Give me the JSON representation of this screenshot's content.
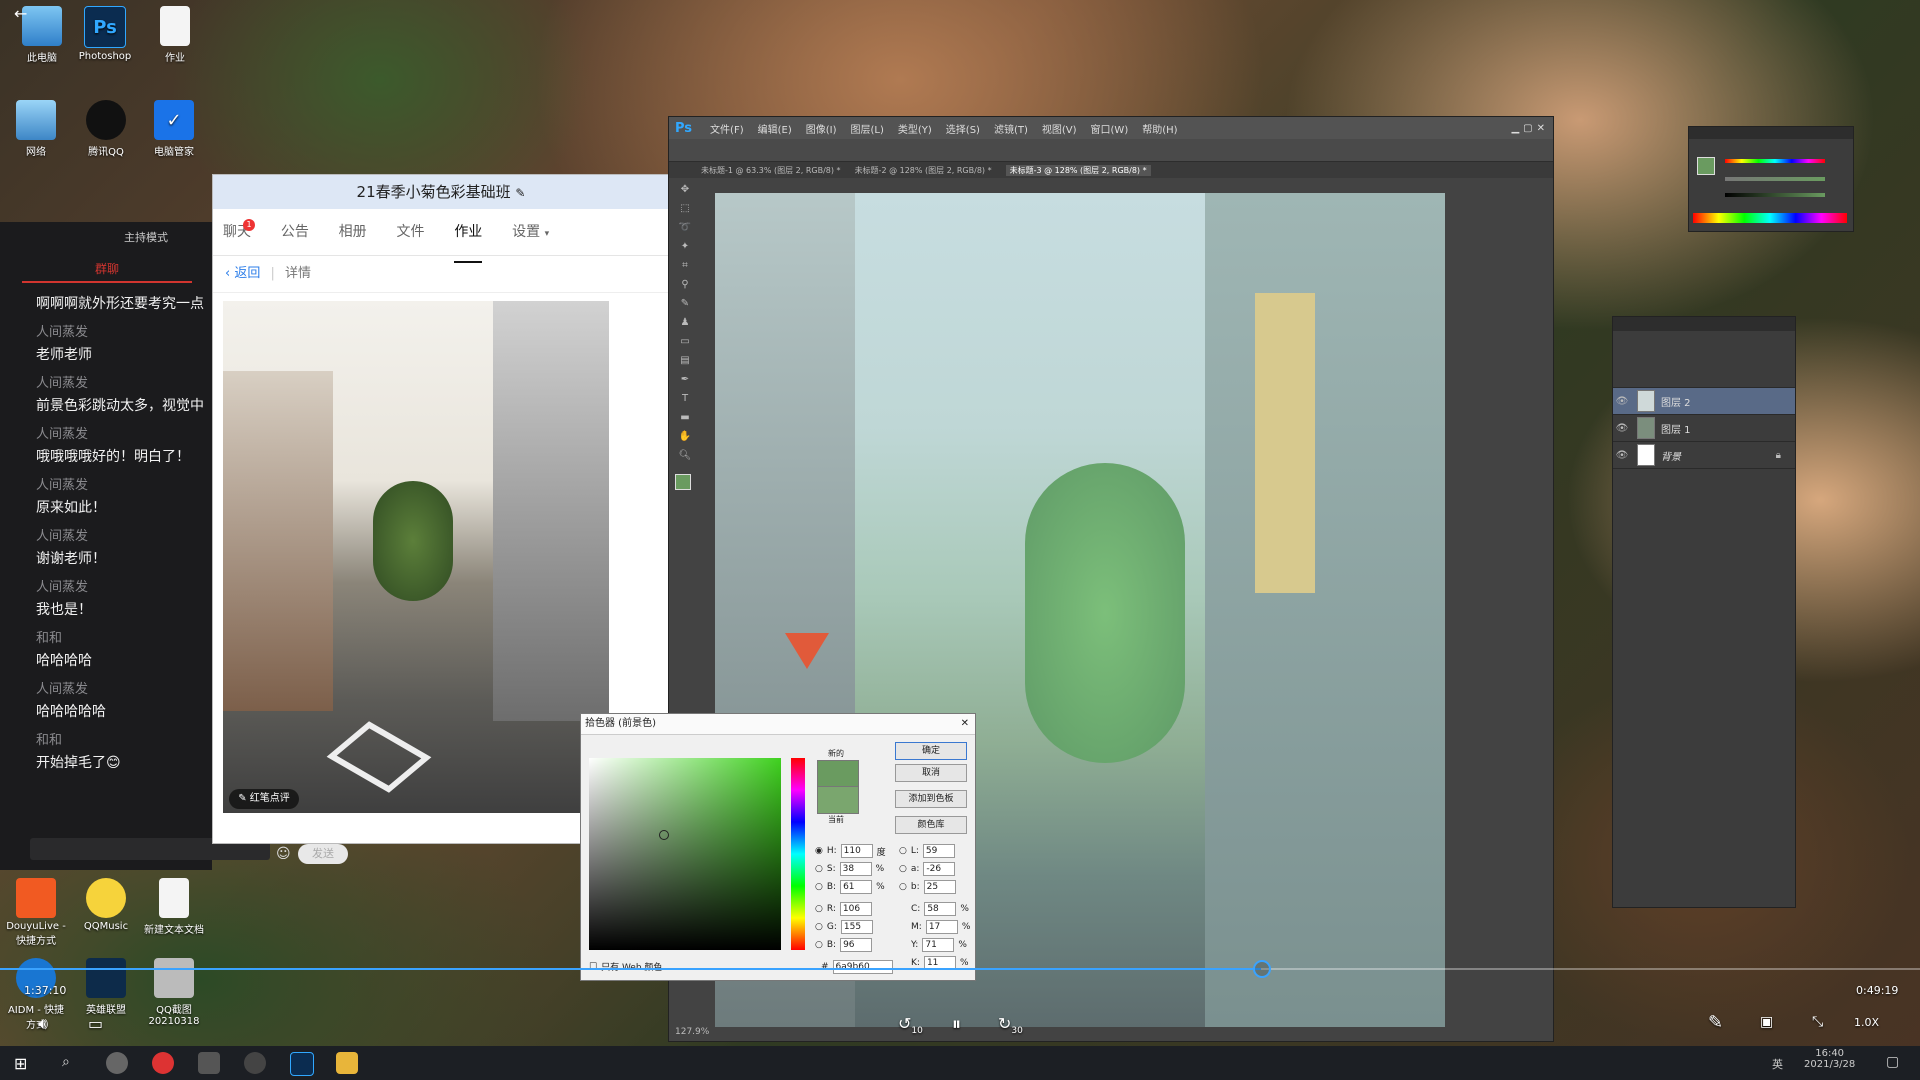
{
  "desktop": {
    "icons_top": [
      {
        "label": "此电脑"
      },
      {
        "label": "Photoshop",
        "glyph": "Ps"
      },
      {
        "label": "作业"
      }
    ],
    "icons_row2": [
      {
        "label": "网络"
      },
      {
        "label": "腾讯QQ"
      },
      {
        "label": "电脑管家"
      }
    ],
    "icons_bottom": [
      {
        "label": "DouyuLive - 快捷方式"
      },
      {
        "label": "QQMusic"
      },
      {
        "label": "新建文本文档"
      },
      {
        "label": "AIDM - 快捷方式"
      },
      {
        "label": "英雄联盟"
      },
      {
        "label": "QQ截图20210318"
      }
    ]
  },
  "chat": {
    "host_mode": "主持模式",
    "tab_label": "群聊",
    "messages": [
      {
        "name": "",
        "text": "啊啊啊就外形还要考究一点"
      },
      {
        "name": "人间蒸发",
        "text": "老师老师"
      },
      {
        "name": "人间蒸发",
        "text": "前景色彩跳动太多，视觉中"
      },
      {
        "name": "人间蒸发",
        "text": "哦哦哦哦好的！明白了！"
      },
      {
        "name": "人间蒸发",
        "text": "原来如此！"
      },
      {
        "name": "人间蒸发",
        "text": "谢谢老师！"
      },
      {
        "name": "人间蒸发",
        "text": "我也是！"
      },
      {
        "name": "和和",
        "text": "哈哈哈哈"
      },
      {
        "name": "人间蒸发",
        "text": "哈哈哈哈哈"
      },
      {
        "name": "和和",
        "text": "开始掉毛了😊"
      }
    ],
    "send_label": "发送"
  },
  "qq": {
    "title": "21春季小菊色彩基础班",
    "tabs": [
      "聊天",
      "公告",
      "相册",
      "文件",
      "作业",
      "设置"
    ],
    "active_tab": "作业",
    "chat_badge": "1",
    "back_label": "返回",
    "detail_label": "详情",
    "review_label": "红笔点评"
  },
  "ps": {
    "logo": "Ps",
    "menus": [
      "文件(F)",
      "编辑(E)",
      "图像(I)",
      "图层(L)",
      "类型(Y)",
      "选择(S)",
      "滤镜(T)",
      "视图(V)",
      "窗口(W)",
      "帮助(H)"
    ],
    "tabs": [
      "未标题-1 @ 63.3% (图层 2, RGB/8) *",
      "未标题-2 @ 128% (图层 2, RGB/8) *",
      "未标题-3 @ 128% (图层 2, RGB/8) *"
    ],
    "status_zoom": "127.9%",
    "layers": [
      "图层 2",
      "图层 1",
      "背景"
    ]
  },
  "picker": {
    "title": "拾色器 (前景色)",
    "buttons": [
      "确定",
      "取消",
      "添加到色板",
      "颜色库"
    ],
    "new_label": "新的",
    "current_label": "当前",
    "hsb": [
      {
        "k": "H:",
        "v": "110",
        "u": "度"
      },
      {
        "k": "S:",
        "v": "38",
        "u": "%"
      },
      {
        "k": "B:",
        "v": "61",
        "u": "%"
      }
    ],
    "rgb": [
      {
        "k": "R:",
        "v": "106"
      },
      {
        "k": "G:",
        "v": "155"
      },
      {
        "k": "B:",
        "v": "96"
      }
    ],
    "lab": [
      {
        "k": "L:",
        "v": "59"
      },
      {
        "k": "a:",
        "v": "-26"
      },
      {
        "k": "b:",
        "v": "25"
      }
    ],
    "cmyk": [
      {
        "k": "C:",
        "v": "58",
        "u": "%"
      },
      {
        "k": "M:",
        "v": "17",
        "u": "%"
      },
      {
        "k": "Y:",
        "v": "71",
        "u": "%"
      },
      {
        "k": "K:",
        "v": "11",
        "u": "%"
      }
    ],
    "hex_label": "#",
    "hex": "6a9b60",
    "web_only": "只有 Web 颜色",
    "new_color": "#6a9b60",
    "current_color": "#7aa66e"
  },
  "player": {
    "elapsed": "1:37:10",
    "total": "0:49:19",
    "progress": 0.657,
    "rewind": "10",
    "forward": "30",
    "speed_label": "1.0X"
  },
  "taskbar": {
    "time": "16:40",
    "date": "2021/3/28",
    "lang": "英"
  },
  "colors": {
    "qq_header": "#dde7f5",
    "ps_bg": "#434343",
    "accent_blue": "#2b7de9"
  }
}
